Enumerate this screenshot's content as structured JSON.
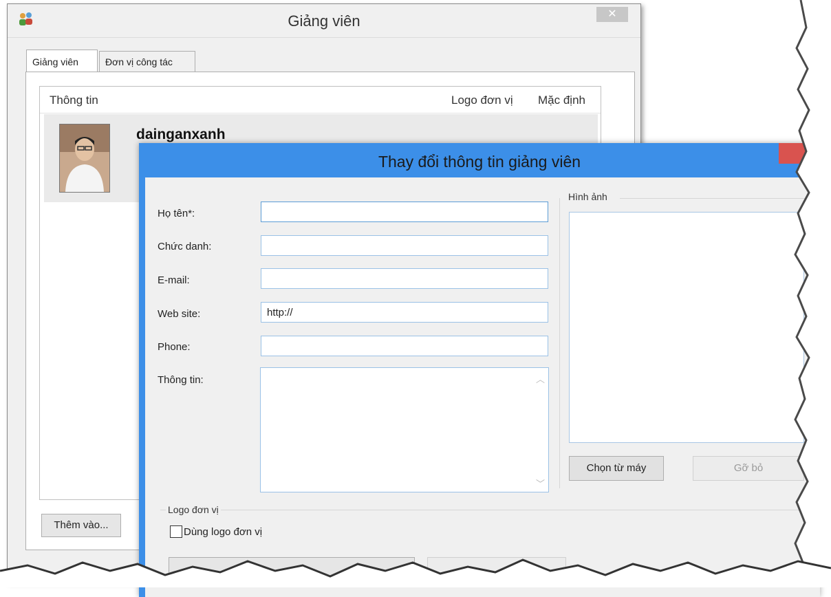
{
  "back_window": {
    "title": "Giảng viên",
    "close_glyph": "✕",
    "tabs": [
      {
        "label": "Giảng viên",
        "active": true
      },
      {
        "label": "Đơn vị công tác",
        "active": false
      }
    ],
    "list": {
      "columns": [
        "Thông tin",
        "Logo đơn vị",
        "Mặc định"
      ],
      "rows": [
        {
          "name": "dainganxanh"
        }
      ]
    },
    "buttons": {
      "add_label": "Thêm vào..."
    }
  },
  "dialog": {
    "title": "Thay đổi thông tin giảng viên",
    "fields": {
      "fullname_label": "Họ tên*:",
      "fullname_value": "",
      "title_label": "Chức danh:",
      "title_value": "",
      "email_label": "E-mail:",
      "email_value": "",
      "website_label": "Web site:",
      "website_value": "http://",
      "phone_label": "Phone:",
      "phone_value": "",
      "info_label": "Thông tin:",
      "info_value": ""
    },
    "image_group": {
      "title": "Hình ảnh",
      "choose_label": "Chọn từ máy",
      "remove_label": "Gỡ bỏ"
    },
    "logo_group": {
      "title": "Logo đơn vị",
      "checkbox_label": "Dùng logo đơn vị",
      "checked": false
    }
  },
  "colors": {
    "dialog_titlebar": "#3c8fe8",
    "field_border": "#9ac1e6",
    "window_bg": "#f0f0f0"
  }
}
